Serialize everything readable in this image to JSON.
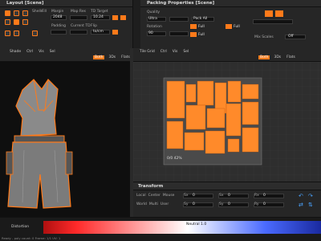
{
  "layout_panel": {
    "title": "Layout [Scene]",
    "col_labels": [
      "Shells",
      "Fill",
      "Margin",
      "Map Res",
      "TD Target"
    ],
    "col_values": [
      "",
      "",
      "2048",
      "",
      "10.24"
    ],
    "row2_labels": [
      "",
      "",
      "Padding",
      "Current TD",
      "Flip"
    ],
    "row2_values": [
      "",
      "",
      "",
      "",
      "to/cm"
    ]
  },
  "packing_panel": {
    "title": "Packing Properties [Scene]",
    "rows": [
      {
        "label": "Quality",
        "value": "Ultra"
      },
      {
        "label": "Rotation",
        "value": "90"
      }
    ],
    "right_values": [
      "Pack All",
      "Full",
      "Full",
      "Full"
    ],
    "far_right_label": "Mix Scales",
    "far_right_value": "Off"
  },
  "viewport_3d": {
    "toolbar_tabs": [
      "Shade",
      "Ctrl",
      "Vis",
      "Sel"
    ],
    "toolbar_right": [
      "Both",
      "3Ds",
      "Flats"
    ]
  },
  "viewport_uv": {
    "toolbar_tabs": [
      "Tile Grid",
      "Ctrl",
      "Vis",
      "Sel"
    ],
    "toolbar_right": [
      "Both",
      "3Ds",
      "Flats"
    ],
    "uv_info": "0/0  42%"
  },
  "transform_panel": {
    "title": "Transform",
    "row1": [
      "Local",
      "Center",
      "Mouse",
      "Sx",
      "0",
      "Sx",
      "0",
      "Rx",
      "0"
    ],
    "row2": [
      "World",
      "Multi",
      "User",
      "Sy",
      "0",
      "Sy",
      "0",
      "Ry",
      "0"
    ]
  },
  "status_bar": {
    "left_label": "Distortion",
    "center_label": "Neutral 1.0",
    "bottom_text": "Ready - poly count: 0  Frame: 1/1  UV: 1"
  },
  "colors": {
    "accent": "#ff7a1a",
    "panel": "#262626",
    "bg": "#1c1c1c"
  }
}
